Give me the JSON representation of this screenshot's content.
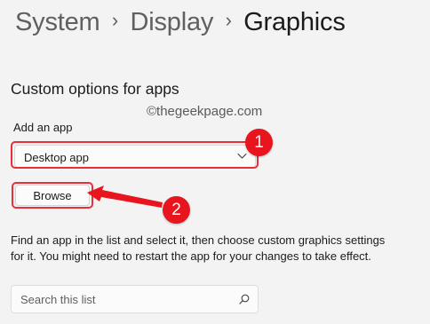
{
  "breadcrumb": {
    "items": [
      "System",
      "Display"
    ],
    "separator": "›",
    "current": "Graphics"
  },
  "section": {
    "title": "Custom options for apps"
  },
  "add_app": {
    "label": "Add an app",
    "selected": "Desktop app"
  },
  "browse_button": {
    "label": "Browse"
  },
  "watermark": "©thegeekpage.com",
  "annotations": {
    "step1": "1",
    "step2": "2",
    "highlight_color": "#e8303a",
    "badge_color": "#e8141e"
  },
  "description": "Find an app in the list and select it, then choose custom graphics settings for it. You might need to restart the app for your changes to take effect.",
  "search": {
    "placeholder": "Search this list",
    "value": "",
    "icon": "search-icon"
  },
  "colors": {
    "background": "#f3f3f3",
    "control_background": "#fbfbfb",
    "text_primary": "#1b1b1b",
    "text_secondary": "#606060"
  }
}
